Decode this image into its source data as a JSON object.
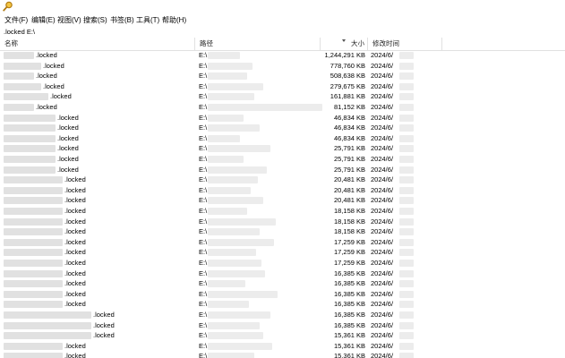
{
  "menu": [
    "文件(F)",
    "编辑(E)",
    "视图(V)",
    "搜索(S)",
    "书签(B)",
    "工具(T)",
    "帮助(H)"
  ],
  "search": {
    "value": ".locked E:\\"
  },
  "columns": {
    "name": "名称",
    "path": "路径",
    "size": "大小",
    "modified": "修改时间"
  },
  "rows": [
    {
      "name": ".locked",
      "path": "E:\\",
      "size": "1,244,291 KB",
      "date": "2024/6/"
    },
    {
      "name": ".locked",
      "path": "E:\\",
      "size": "778,760 KB",
      "date": "2024/6/"
    },
    {
      "name": ".locked",
      "path": "E:\\",
      "size": "508,638 KB",
      "date": "2024/6/"
    },
    {
      "name": ".locked",
      "path": "E:\\",
      "size": "279,675 KB",
      "date": "2024/6/"
    },
    {
      "name": ".locked",
      "path": "E:\\",
      "size": "161,881 KB",
      "date": "2024/6/"
    },
    {
      "name": ".locked",
      "path": "E:\\",
      "size": "81,152 KB",
      "date": "2024/6/"
    },
    {
      "name": ".locked",
      "path": "E:\\",
      "size": "46,834 KB",
      "date": "2024/6/"
    },
    {
      "name": ".locked",
      "path": "E:\\",
      "size": "46,834 KB",
      "date": "2024/6/"
    },
    {
      "name": ".locked",
      "path": "E:\\",
      "size": "46,834 KB",
      "date": "2024/6/"
    },
    {
      "name": ".locked",
      "path": "E:\\",
      "size": "25,791 KB",
      "date": "2024/6/"
    },
    {
      "name": ".locked",
      "path": "E:\\",
      "size": "25,791 KB",
      "date": "2024/6/"
    },
    {
      "name": ".locked",
      "path": "E:\\",
      "size": "25,791 KB",
      "date": "2024/6/"
    },
    {
      "name": ".locked",
      "path": "E:\\",
      "size": "20,481 KB",
      "date": "2024/6/"
    },
    {
      "name": ".locked",
      "path": "E:\\",
      "size": "20,481 KB",
      "date": "2024/6/"
    },
    {
      "name": ".locked",
      "path": "E:\\",
      "size": "20,481 KB",
      "date": "2024/6/"
    },
    {
      "name": ".locked",
      "path": "E:\\",
      "size": "18,158 KB",
      "date": "2024/6/"
    },
    {
      "name": ".locked",
      "path": "E:\\",
      "size": "18,158 KB",
      "date": "2024/6/"
    },
    {
      "name": ".locked",
      "path": "E:\\",
      "size": "18,158 KB",
      "date": "2024/6/"
    },
    {
      "name": ".locked",
      "path": "E:\\",
      "size": "17,259 KB",
      "date": "2024/6/"
    },
    {
      "name": ".locked",
      "path": "E:\\",
      "size": "17,259 KB",
      "date": "2024/6/"
    },
    {
      "name": ".locked",
      "path": "E:\\",
      "size": "17,259 KB",
      "date": "2024/6/"
    },
    {
      "name": ".locked",
      "path": "E:\\",
      "size": "16,385 KB",
      "date": "2024/6/"
    },
    {
      "name": ".locked",
      "path": "E:\\",
      "size": "16,385 KB",
      "date": "2024/6/"
    },
    {
      "name": ".locked",
      "path": "E:\\",
      "size": "16,385 KB",
      "date": "2024/6/"
    },
    {
      "name": ".locked",
      "path": "E:\\",
      "size": "16,385 KB",
      "date": "2024/6/"
    },
    {
      "name": ".locked",
      "path": "E:\\",
      "size": "16,385 KB",
      "date": "2024/6/"
    },
    {
      "name": ".locked",
      "path": "E:\\",
      "size": "16,385 KB",
      "date": "2024/6/"
    },
    {
      "name": ".locked",
      "path": "E:\\",
      "size": "15,361 KB",
      "date": "2024/6/"
    },
    {
      "name": ".locked",
      "path": "E:\\",
      "size": "15,361 KB",
      "date": "2024/6/"
    },
    {
      "name": ".locked",
      "path": "E:\\",
      "size": "15,361 KB",
      "date": "2024/6/"
    }
  ]
}
